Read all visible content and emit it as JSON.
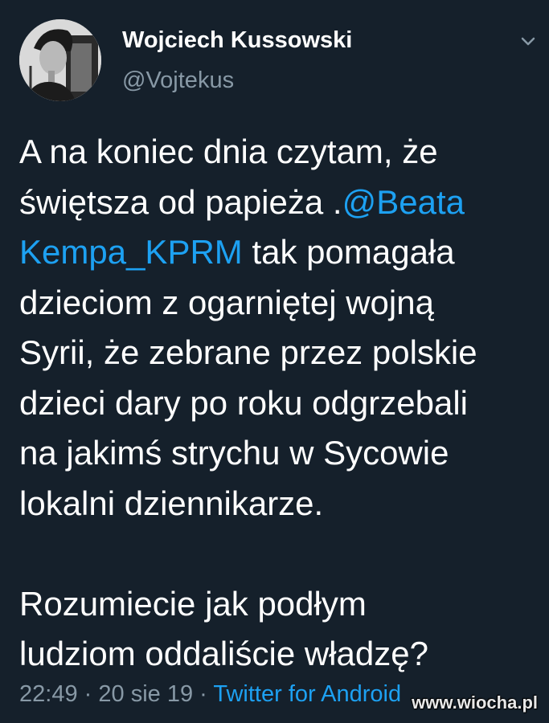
{
  "author": {
    "display_name": "Wojciech Kussowski",
    "handle": "@Vojtekus"
  },
  "tweet": {
    "lines": [
      [
        {
          "text": "A na koniec dnia czytam, że"
        }
      ],
      [
        {
          "text": "świętsza od papieża ."
        },
        {
          "text": "@Beata",
          "mention": true
        }
      ],
      [
        {
          "text": "Kempa_KPRM",
          "mention": true
        },
        {
          "text": " tak pomagała"
        }
      ],
      [
        {
          "text": "dzieciom z ogarniętej wojną"
        }
      ],
      [
        {
          "text": "Syrii, że zebrane przez polskie"
        }
      ],
      [
        {
          "text": "dzieci dary po roku odgrzebali"
        }
      ],
      [
        {
          "text": "na jakimś strychu w Sycowie"
        }
      ],
      [
        {
          "text": "lokalni dziennikarze."
        }
      ],
      [],
      [
        {
          "text": "Rozumiecie jak podłym"
        }
      ],
      [
        {
          "text": "ludziom oddaliście władzę?"
        }
      ]
    ]
  },
  "meta": {
    "time": "22:49",
    "separator": "·",
    "date": "20 sie 19",
    "source": "Twitter for Android"
  },
  "watermark": "www.wiocha.pl",
  "colors": {
    "background": "#15202b",
    "text": "#ffffff",
    "secondary": "#8899a6",
    "link": "#1da1f2"
  }
}
